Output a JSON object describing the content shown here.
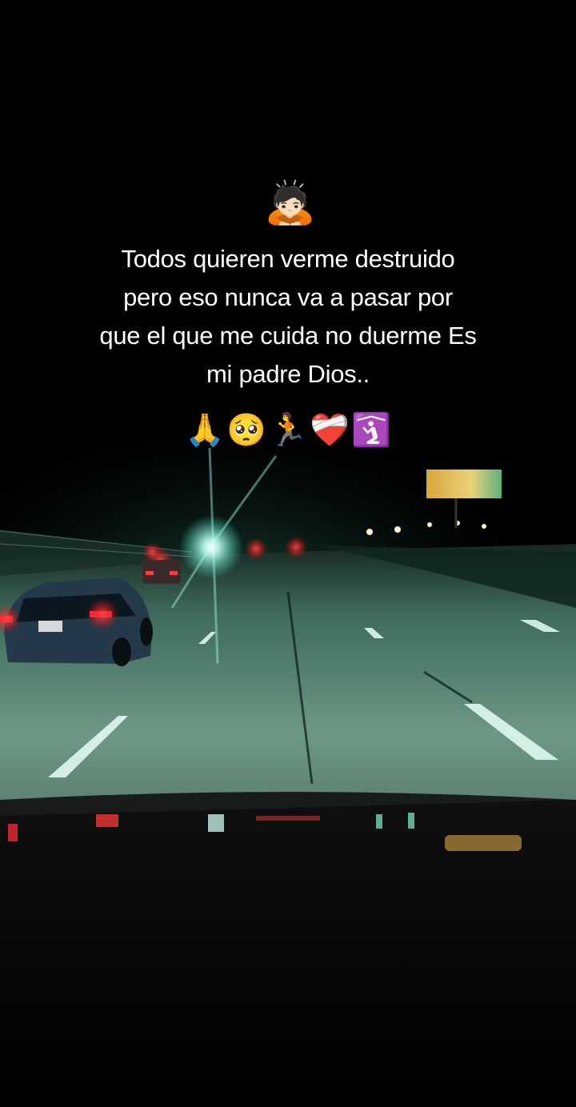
{
  "post": {
    "top_emoji": "🙇🏻",
    "caption_lines": [
      "Todos quieren verme destruido",
      "pero eso nunca va a pasar por",
      "que el que me cuida no duerme Es",
      "mi padre Dios.."
    ],
    "emoji_row": [
      "🙏",
      "🥺",
      "🏃",
      "❤️‍🩹",
      "🛐"
    ]
  },
  "scene": {
    "description_colors": {
      "sky": "#000000",
      "road": "#5f8a77",
      "light_glow": "#9ff5e6",
      "tail_light": "#ff2a3a",
      "billboard": "#e6c35a"
    }
  }
}
